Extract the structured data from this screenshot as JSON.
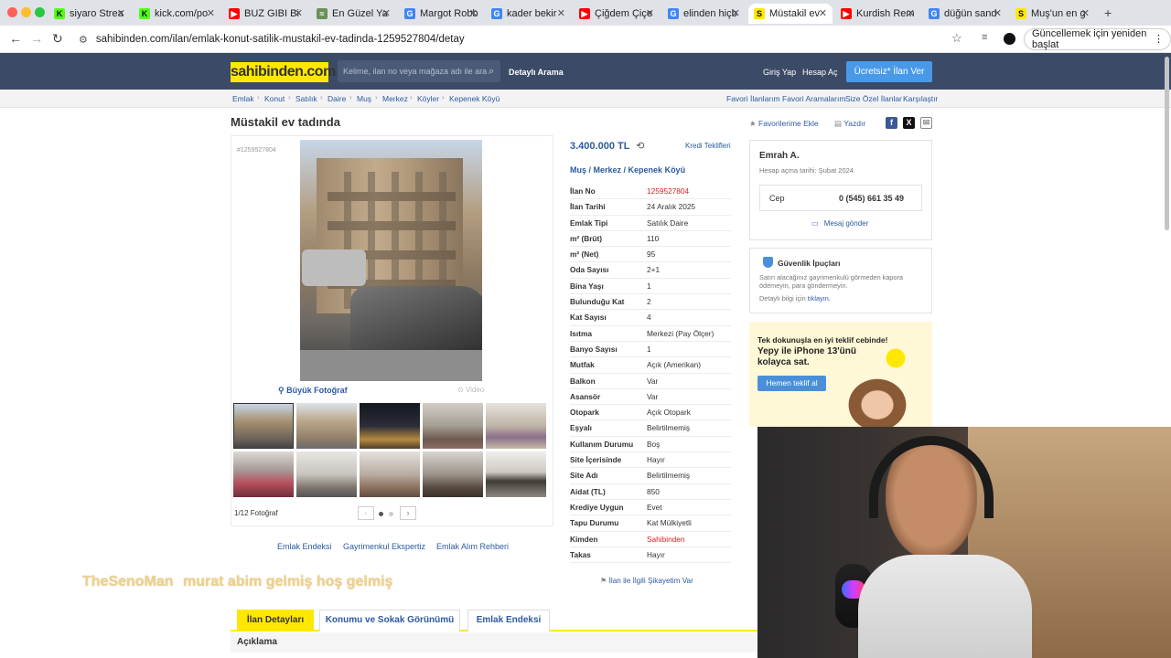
{
  "browser": {
    "tabs": [
      {
        "title": "siyaro Strea",
        "fav": "K",
        "color": "#53fc18"
      },
      {
        "title": "kick.com/po",
        "fav": "K",
        "color": "#53fc18"
      },
      {
        "title": "BUZ GIBI Bi",
        "fav": "▶",
        "color": "#ff0000"
      },
      {
        "title": "En Güzel Ya",
        "fav": "≈",
        "color": "#6a8f5a"
      },
      {
        "title": "Margot Robb",
        "fav": "G",
        "color": "#4285f4"
      },
      {
        "title": "kader bekir",
        "fav": "G",
        "color": "#4285f4"
      },
      {
        "title": "Çiğdem Çiçe",
        "fav": "▶",
        "color": "#ff0000"
      },
      {
        "title": "elinden hiçb",
        "fav": "G",
        "color": "#4285f4"
      },
      {
        "title": "Müstakil ev",
        "fav": "S",
        "color": "#ffe800"
      },
      {
        "title": "Kurdish Rem",
        "fav": "▶",
        "color": "#ff0000"
      },
      {
        "title": "düğün sand",
        "fav": "G",
        "color": "#4285f4"
      },
      {
        "title": "Muş'un en g",
        "fav": "S",
        "color": "#ffe800"
      }
    ],
    "url": "sahibinden.com/ilan/emlak-konut-satilik-mustakil-ev-tadinda-1259527804/detay",
    "update_label": "Güncellemek için yeniden başlat"
  },
  "header": {
    "logo": "sahibinden.com",
    "search_placeholder": "Kelime, ilan no veya mağaza adı ile ara",
    "detailed_search": "Detaylı Arama",
    "login": "Giriş Yap",
    "signup": "Hesap Aç",
    "free_ad": "Ücretsiz* İlan Ver"
  },
  "breadcrumb": [
    "Emlak",
    "Konut",
    "Satılık",
    "Daire",
    "Muş",
    "Merkez",
    "Köyler",
    "Kepenek Köyü"
  ],
  "crumb_right": [
    "Favori İlanlarım",
    "Favori Aramalarım",
    "Size Özel İlanlar",
    "Karşılaştır"
  ],
  "listing": {
    "title": "Müstakil ev tadında",
    "favorite": "Favorilerime Ekle",
    "print": "Yazdır",
    "ad_no_small": "#1259527804",
    "big_photo": "Büyük Fotoğraf",
    "video": "Video",
    "photo_count": "1/12 Fotoğraf",
    "price": "3.400.000 TL",
    "credit": "Kredi Teklifleri",
    "location": [
      "Muş",
      "Merkez",
      "Kepenek Köyü"
    ],
    "specs": [
      {
        "k": "İlan No",
        "v": "1259527804",
        "red": true
      },
      {
        "k": "İlan Tarihi",
        "v": "24 Aralık 2025"
      },
      {
        "k": "Emlak Tipi",
        "v": "Satılık Daire"
      },
      {
        "k": "m² (Brüt)",
        "v": "110"
      },
      {
        "k": "m² (Net)",
        "v": "95"
      },
      {
        "k": "Oda Sayısı",
        "v": "2+1"
      },
      {
        "k": "Bina Yaşı",
        "v": "1"
      },
      {
        "k": "Bulunduğu Kat",
        "v": "2"
      },
      {
        "k": "Kat Sayısı",
        "v": "4"
      },
      {
        "k": "Isıtma",
        "v": "Merkezi (Pay Ölçer)"
      },
      {
        "k": "Banyo Sayısı",
        "v": "1"
      },
      {
        "k": "Mutfak",
        "v": "Açık (Amerikan)"
      },
      {
        "k": "Balkon",
        "v": "Var"
      },
      {
        "k": "Asansör",
        "v": "Var"
      },
      {
        "k": "Otopark",
        "v": "Açık Otopark"
      },
      {
        "k": "Eşyalı",
        "v": "Belirtilmemiş"
      },
      {
        "k": "Kullanım Durumu",
        "v": "Boş"
      },
      {
        "k": "Site İçerisinde",
        "v": "Hayır"
      },
      {
        "k": "Site Adı",
        "v": "Belirtilmemiş"
      },
      {
        "k": "Aidat (TL)",
        "v": "850"
      },
      {
        "k": "Krediye Uygun",
        "v": "Evet"
      },
      {
        "k": "Tapu Durumu",
        "v": "Kat Mülkiyetli"
      },
      {
        "k": "Kimden",
        "v": "Sahibinden",
        "red": true
      },
      {
        "k": "Takas",
        "v": "Hayır"
      }
    ],
    "complaint": "İlan ile İlgili Şikayetim Var",
    "bottom_links": [
      "Emlak Endeksi",
      "Gayrimenkul Ekspertiz",
      "Emlak Alım Rehberi"
    ]
  },
  "seller": {
    "name": "Emrah A.",
    "since": "Hesap açma tarihi: Şubat 2024",
    "phone_label": "Cep",
    "phone": "0 (545) 661 35 49",
    "message": "Mesaj gönder"
  },
  "safety": {
    "title": "Güvenlik İpuçları",
    "text": "Satın alacağınız gayrimenkulü görmeden kapora ödemeyin, para göndermeyin.",
    "more_prefix": "Detaylı bilgi için",
    "more_link": "tıklayın."
  },
  "promo": {
    "line1": "Tek dokunuşla en iyi teklif cebinde!",
    "line2": "Yepy ile iPhone 13'ünü kolayca sat.",
    "cta": "Hemen teklif al"
  },
  "watermark": {
    "user": "TheSenoMan",
    "message": "murat abim gelmiş hoş gelmiş"
  },
  "detail_tabs": [
    "İlan Detayları",
    "Konumu ve Sokak Görünümü",
    "Emlak Endeksi"
  ],
  "description_header": "Açıklama"
}
